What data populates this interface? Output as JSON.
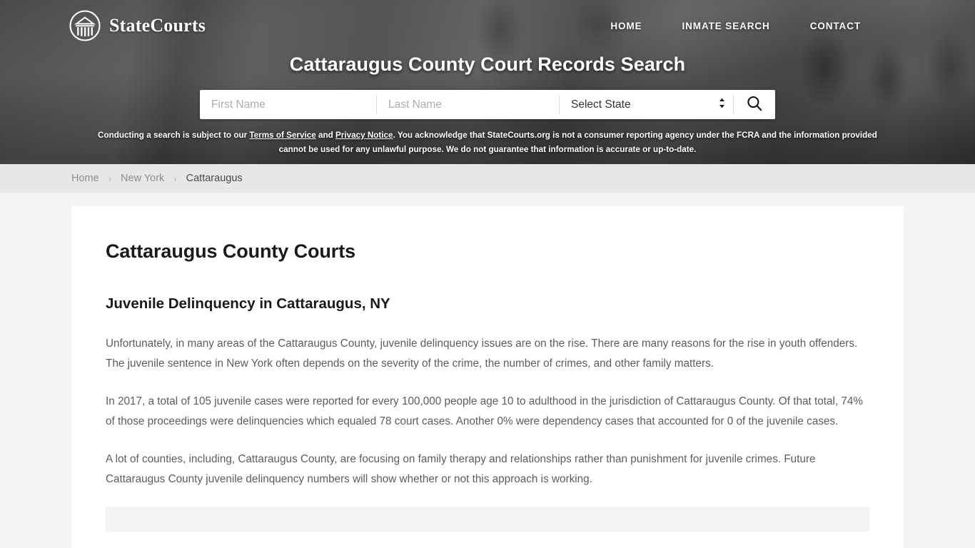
{
  "header": {
    "brand_name": "StateCourts",
    "brand_icon": "courthouse-circle-logo",
    "nav": [
      {
        "label": "HOME"
      },
      {
        "label": "INMATE SEARCH"
      },
      {
        "label": "CONTACT"
      }
    ],
    "title": "Cattaraugus County Court Records Search",
    "search": {
      "first_name_placeholder": "First Name",
      "first_name_value": "",
      "last_name_placeholder": "Last Name",
      "last_name_value": "",
      "state_selected": "Select State",
      "state_options": [
        "Select State"
      ],
      "search_icon": "magnifier-icon",
      "select_chevron_icon": "chevron-up-down-icon"
    },
    "disclaimer": {
      "part1": "Conducting a search is subject to our ",
      "link1": "Terms of Service",
      "part2": " and ",
      "link2": "Privacy Notice",
      "part3": ". You acknowledge that StateCourts.org is not a consumer reporting agency under the FCRA and the information provided cannot be used for any unlawful purpose. We do not guarantee that information is accurate or up-to-date."
    }
  },
  "breadcrumb": {
    "items": [
      {
        "label": "Home",
        "active": false
      },
      {
        "label": "New York",
        "active": false
      },
      {
        "label": "Cattaraugus",
        "active": true
      }
    ],
    "separator": "›"
  },
  "main": {
    "page_title": "Cattaraugus County Courts",
    "section_heading": "Juvenile Delinquency in Cattaraugus, NY",
    "paragraphs": [
      "Unfortunately, in many areas of the Cattaraugus County, juvenile delinquency issues are on the rise. There are many reasons for the rise in youth offenders. The juvenile sentence in New York often depends on the severity of the crime, the number of crimes, and other family matters.",
      "In 2017, a total of 105 juvenile cases were reported for every 100,000 people age 10 to adulthood in the jurisdiction of Cattaraugus County. Of that total, 74% of those proceedings were delinquencies which equaled 78 court cases. Another 0% were dependency cases that accounted for 0 of the juvenile cases.",
      "A lot of counties, including, Cattaraugus County, are focusing on family therapy and relationships rather than punishment for juvenile crimes. Future Cattaraugus County juvenile delinquency numbers will show whether or not this approach is working."
    ]
  },
  "colors": {
    "hero_background": "#6a6a6a",
    "breadcrumb_background": "#e7e7e7",
    "page_background": "#f4f4f4",
    "card_background": "#ffffff",
    "body_text": "#5d5d5d",
    "heading_text": "#1a1a1a"
  }
}
